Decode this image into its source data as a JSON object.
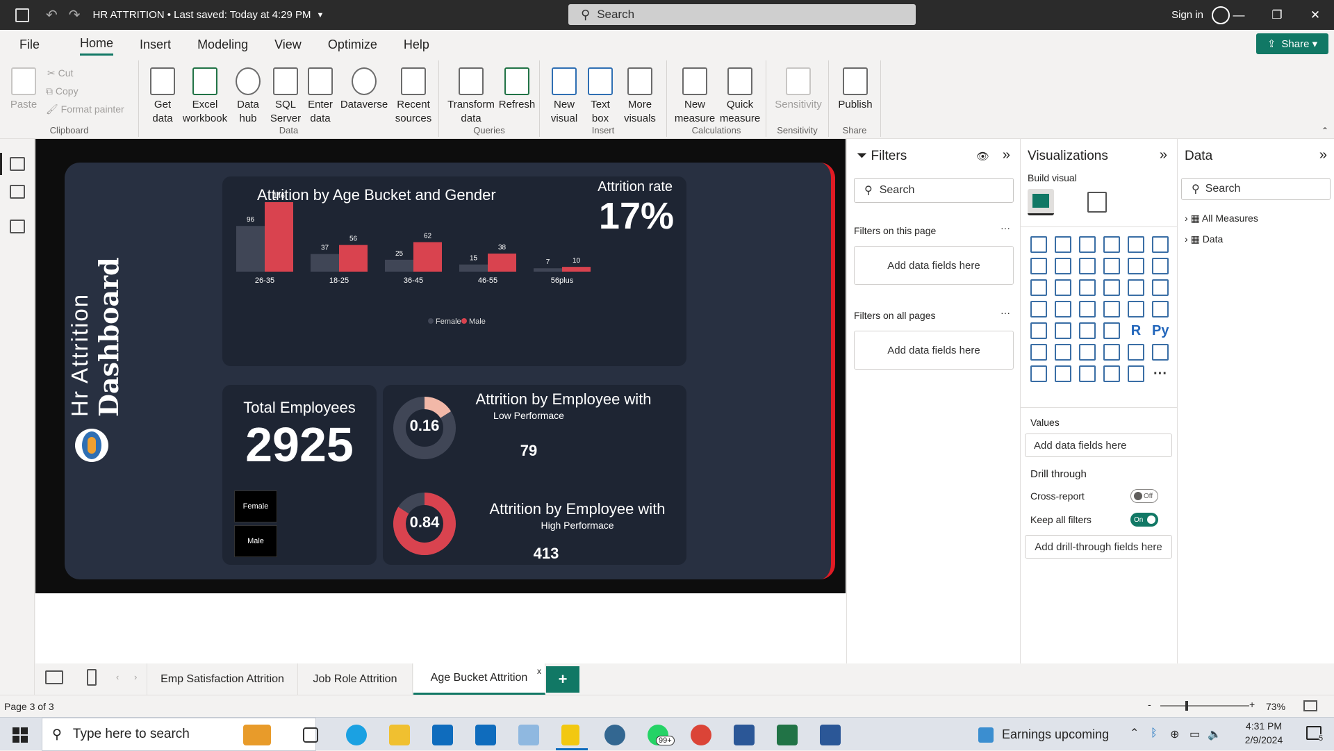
{
  "titlebar": {
    "file_title": "HR ATTRITION",
    "save_status": "• Last saved: Today at 4:29 PM",
    "search_placeholder": "Search",
    "signin": "Sign in"
  },
  "menu": {
    "tabs": [
      "File",
      "Home",
      "Insert",
      "Modeling",
      "View",
      "Optimize",
      "Help"
    ],
    "share": "Share"
  },
  "ribbon": {
    "clipboard": {
      "label": "Clipboard",
      "paste": "Paste",
      "cut": "Cut",
      "copy": "Copy",
      "format_painter": "Format painter"
    },
    "data": {
      "label": "Data",
      "get_data": "Get\ndata",
      "excel": "Excel\nworkbook",
      "data_hub": "Data\nhub",
      "sql": "SQL\nServer",
      "enter": "Enter\ndata",
      "dataverse": "Dataverse",
      "recent": "Recent\nsources"
    },
    "queries": {
      "label": "Queries",
      "transform": "Transform\ndata",
      "refresh": "Refresh"
    },
    "insert": {
      "label": "Insert",
      "new_visual": "New\nvisual",
      "text_box": "Text\nbox",
      "more_visuals": "More\nvisuals"
    },
    "calculations": {
      "label": "Calculations",
      "new_measure": "New\nmeasure",
      "quick_measure": "Quick\nmeasure"
    },
    "sensitivity": {
      "label": "Sensitivity",
      "sensitivity": "Sensitivity"
    },
    "share": {
      "label": "Share",
      "publish": "Publish"
    }
  },
  "dashboard": {
    "side_title_1": "Hr Attrition",
    "side_title_2": "Dashboard",
    "chart_title": "Attrition by Age Bucket and Gender",
    "attrition_rate_label": "Attrition rate",
    "attrition_rate_value": "17%",
    "total_employees_label": "Total Employees",
    "total_employees_value": "2925",
    "slicer_female": "Female",
    "slicer_male": "Male",
    "low_perf_title": "Attrition by Employee with",
    "low_perf_sub": "Low Performace",
    "low_perf_value": "79",
    "low_perf_ratio": "0.16",
    "high_perf_title": "Attrition by Employee with",
    "high_perf_sub": "High Performace",
    "high_perf_value": "413",
    "high_perf_ratio": "0.84",
    "colors": {
      "female": "#404656",
      "male": "#d9434f",
      "card": "#1e2533",
      "bg": "#283041"
    }
  },
  "chart_data": {
    "type": "bar",
    "title": "Attrition by Age Bucket and Gender",
    "categories": [
      "26-35",
      "18-25",
      "36-45",
      "46-55",
      "56plus"
    ],
    "series": [
      {
        "name": "Female",
        "values": [
          96,
          37,
          25,
          15,
          7
        ]
      },
      {
        "name": "Male",
        "values": [
          146,
          56,
          62,
          38,
          10
        ]
      }
    ],
    "legend": "bottom-center",
    "grid": false
  },
  "filters": {
    "title": "Filters",
    "search": "Search",
    "on_page": "Filters on this page",
    "on_all": "Filters on all pages",
    "add_fields": "Add data fields here"
  },
  "visualizations": {
    "title": "Visualizations",
    "build": "Build visual",
    "values": "Values",
    "add_fields": "Add data fields here",
    "drill_through": "Drill through",
    "cross_report": "Cross-report",
    "cross_report_state": "Off",
    "keep_filters": "Keep all filters",
    "keep_filters_state": "On",
    "add_drill": "Add drill-through fields here",
    "more": "···"
  },
  "data_pane": {
    "title": "Data",
    "search": "Search",
    "items": [
      "All Measures",
      "Data"
    ]
  },
  "pages": {
    "tabs": [
      "Emp Satisfaction Attrition",
      "Job Role Attrition",
      "Age Bucket Attrition"
    ],
    "close": "x",
    "add": "+",
    "status": "Page 3 of 3",
    "zoom": "73%"
  },
  "taskbar": {
    "search": "Type here to search",
    "badge": "99+",
    "earnings": "Earnings upcoming",
    "time": "4:31 PM",
    "date": "2/9/2024",
    "notif": "5"
  }
}
